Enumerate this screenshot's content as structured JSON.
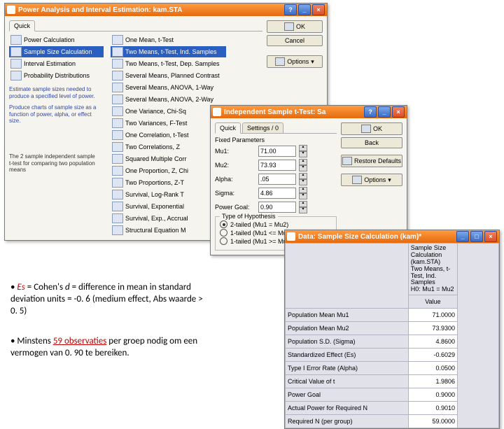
{
  "w1": {
    "title": "Power Analysis and Interval Estimation: kam.STA",
    "quick": "Quick",
    "ok": "OK",
    "cancel": "Cancel",
    "options": "Options",
    "left": [
      "Power Calculation",
      "Sample Size Calculation",
      "Interval Estimation",
      "Probability Distributions"
    ],
    "mid": [
      "One Mean, t-Test",
      "Two Means, t-Test, Ind. Samples",
      "Two Means, t-Test, Dep. Samples",
      "Several Means, Planned Contrast",
      "Several Means, ANOVA, 1-Way",
      "Several Means, ANOVA, 2-Way",
      "One Variance, Chi-Sq",
      "Two Variances, F-Test",
      "One Correlation, t-Test",
      "Two Correlations, Z",
      "Squared Multiple Corr",
      "One Proportion, Z, Chi",
      "Two Proportions, Z-T",
      "Survival, Log-Rank T",
      "Survival, Exponential",
      "Survival, Exp., Accrual",
      "Structural Equation M"
    ],
    "h1": "Estimate sample sizes needed to produce a specified level of power.",
    "h2": "Produce charts of sample size as a function of power, alpha, or effect size.",
    "h3": "The 2 sample independent sample t-test for comparing two population means"
  },
  "w2": {
    "title": "Independent Sample t-Test: Sa",
    "quick": "Quick",
    "settings": "Settings / 0",
    "ok": "OK",
    "back": "Back",
    "restore": "Restore Defaults",
    "options": "Options",
    "fixed": "Fixed Parameters",
    "mu1l": "Mu1:",
    "mu1": "71.00",
    "mu2l": "Mu2:",
    "mu2": "73.93",
    "alphal": "Alpha:",
    "alpha": ".05",
    "sigmal": "Sigma:",
    "sigma": "4.86",
    "pgl": "Power Goal:",
    "pg": "0.90",
    "hyp": "Type of Hypothesis",
    "r1": "2-tailed (Mu1 = Mu2)",
    "r2": "1-tailed (Mu1 <= Mu2)",
    "r3": "1-tailed (Mu1 >= Mu2)"
  },
  "w3": {
    "title": "Data: Sample Size Calculation (kam)*",
    "h0": "Sample Size Calculation (kam.STA)",
    "h1": "Two Means, t-Test, Ind. Samples",
    "h2": "H0: Mu1 = Mu2",
    "hv": "Value",
    "rows": [
      [
        "Population Mean Mu1",
        "71.0000"
      ],
      [
        "Population Mean Mu2",
        "73.9300"
      ],
      [
        "Population S.D. (Sigma)",
        "4.8600"
      ],
      [
        "Standardized Effect (Es)",
        "-0.6029"
      ],
      [
        "Type I Error Rate (Alpha)",
        "0.0500"
      ],
      [
        "Critical Value of t",
        "1.9806"
      ],
      [
        "Power Goal",
        "0.9000"
      ],
      [
        "Actual Power for Required N",
        "0.9010"
      ],
      [
        "Required N (per group)",
        "59.0000"
      ]
    ]
  },
  "n1": {
    "a": "• ",
    "b": "Es",
    "c": " = Cohen's ",
    "d": "d",
    "e": " = difference in mean in standard deviation units = -0. 6 (medium effect, Abs waarde > 0. 5)"
  },
  "n2": {
    "a": "• Minstens ",
    "b": "59 observaties",
    "c": " per groep nodig om een vermogen van 0. 90 te bereiken."
  }
}
